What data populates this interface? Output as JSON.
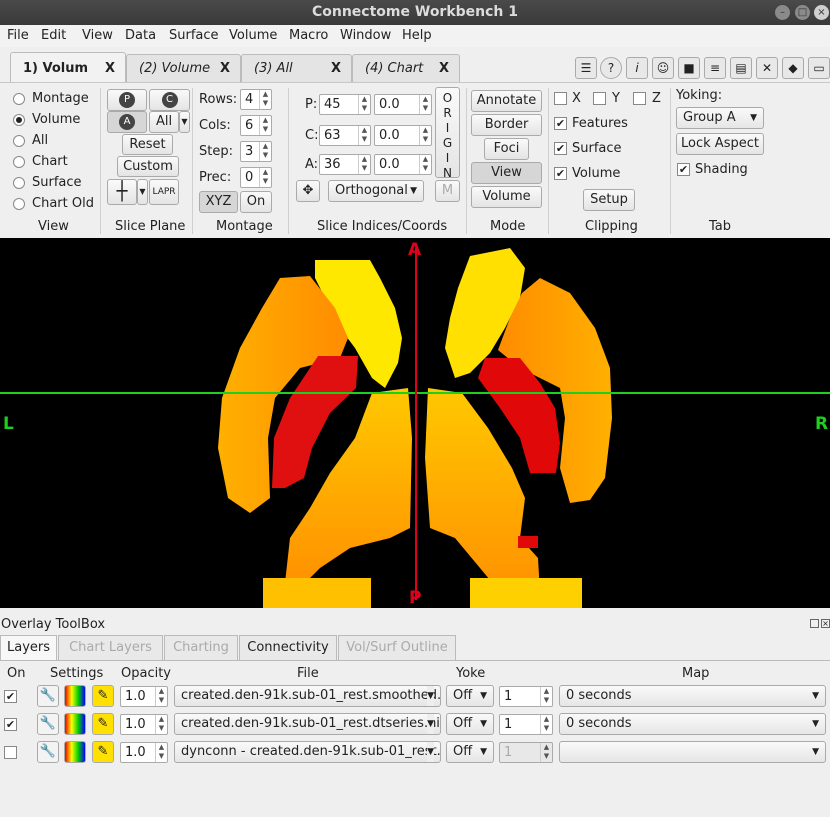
{
  "window": {
    "title": "Connectome Workbench 1"
  },
  "menu": [
    "File",
    "Edit",
    "View",
    "Data",
    "Surface",
    "Volume",
    "Macro",
    "Window",
    "Help"
  ],
  "tabs": [
    {
      "label": "1) Volum",
      "active": true
    },
    {
      "label": "(2) Volume",
      "active": false
    },
    {
      "label": "(3) All",
      "active": false
    },
    {
      "label": "(4) Chart",
      "active": false
    }
  ],
  "tab_close": "X",
  "view_group": {
    "label": "View",
    "options": [
      "Montage",
      "Volume",
      "All",
      "Chart",
      "Surface",
      "Chart Old"
    ],
    "selected": "Volume"
  },
  "slice_plane": {
    "label": "Slice Plane",
    "p": "P",
    "c": "C",
    "a": "A",
    "all": "All",
    "reset": "Reset",
    "custom": "Custom",
    "lpr": "LAPR"
  },
  "montage": {
    "label": "Montage",
    "rows_label": "Rows:",
    "rows": "4",
    "cols_label": "Cols:",
    "cols": "6",
    "step_label": "Step:",
    "step": "3",
    "prec_label": "Prec:",
    "prec": "0",
    "xyz": "XYZ",
    "on": "On"
  },
  "slice_indices": {
    "label": "Slice Indices/Coords",
    "p_label": "P:",
    "p_index": "45",
    "p_coord": "0.0",
    "c_label": "C:",
    "c_index": "63",
    "c_coord": "0.0",
    "a_label": "A:",
    "a_index": "36",
    "a_coord": "0.0",
    "origin": [
      "O",
      "R",
      "I",
      "G",
      "I",
      "N"
    ],
    "projection": "Orthogonal",
    "m": "M"
  },
  "mode": {
    "label": "Mode",
    "buttons": [
      "Annotate",
      "Border",
      "Foci",
      "View",
      "Volume"
    ],
    "selected": "View"
  },
  "clipping": {
    "label": "Clipping",
    "x": "X",
    "y": "Y",
    "z": "Z",
    "features": "Features",
    "surface": "Surface",
    "volume": "Volume",
    "setup": "Setup"
  },
  "tab_group": {
    "label": "Tab",
    "yoking_label": "Yoking:",
    "yoking": "Group A",
    "lock_aspect": "Lock Aspect",
    "shading": "Shading"
  },
  "viewer": {
    "left": "L",
    "right": "R",
    "anterior": "A",
    "posterior": "P",
    "vertical_line_color": "#e0001c",
    "horizontal_line_color": "#1ed01e"
  },
  "overlay": {
    "title": "Overlay ToolBox",
    "tabs": [
      {
        "label": "Layers",
        "state": "active"
      },
      {
        "label": "Chart Layers",
        "state": "disabled"
      },
      {
        "label": "Charting",
        "state": "disabled"
      },
      {
        "label": "Connectivity",
        "state": "normal"
      },
      {
        "label": "Vol/Surf Outline",
        "state": "disabled"
      }
    ],
    "headers": {
      "on": "On",
      "settings": "Settings",
      "opacity": "Opacity",
      "file": "File",
      "yoke": "Yoke",
      "map": "Map"
    },
    "rows": [
      {
        "on": true,
        "opacity": "1.0",
        "file": "created.den-91k.sub-01_rest.smoothed.",
        "yoke": "Off",
        "map_index": "1",
        "map": "0 seconds"
      },
      {
        "on": true,
        "opacity": "1.0",
        "file": "created.den-91k.sub-01_rest.dtseries.nii",
        "yoke": "Off",
        "map_index": "1",
        "map": "0 seconds"
      },
      {
        "on": false,
        "opacity": "1.0",
        "file": "dynconn - created.den-91k.sub-01_rest.",
        "yoke": "Off",
        "map_index": "1",
        "map": ""
      }
    ]
  }
}
